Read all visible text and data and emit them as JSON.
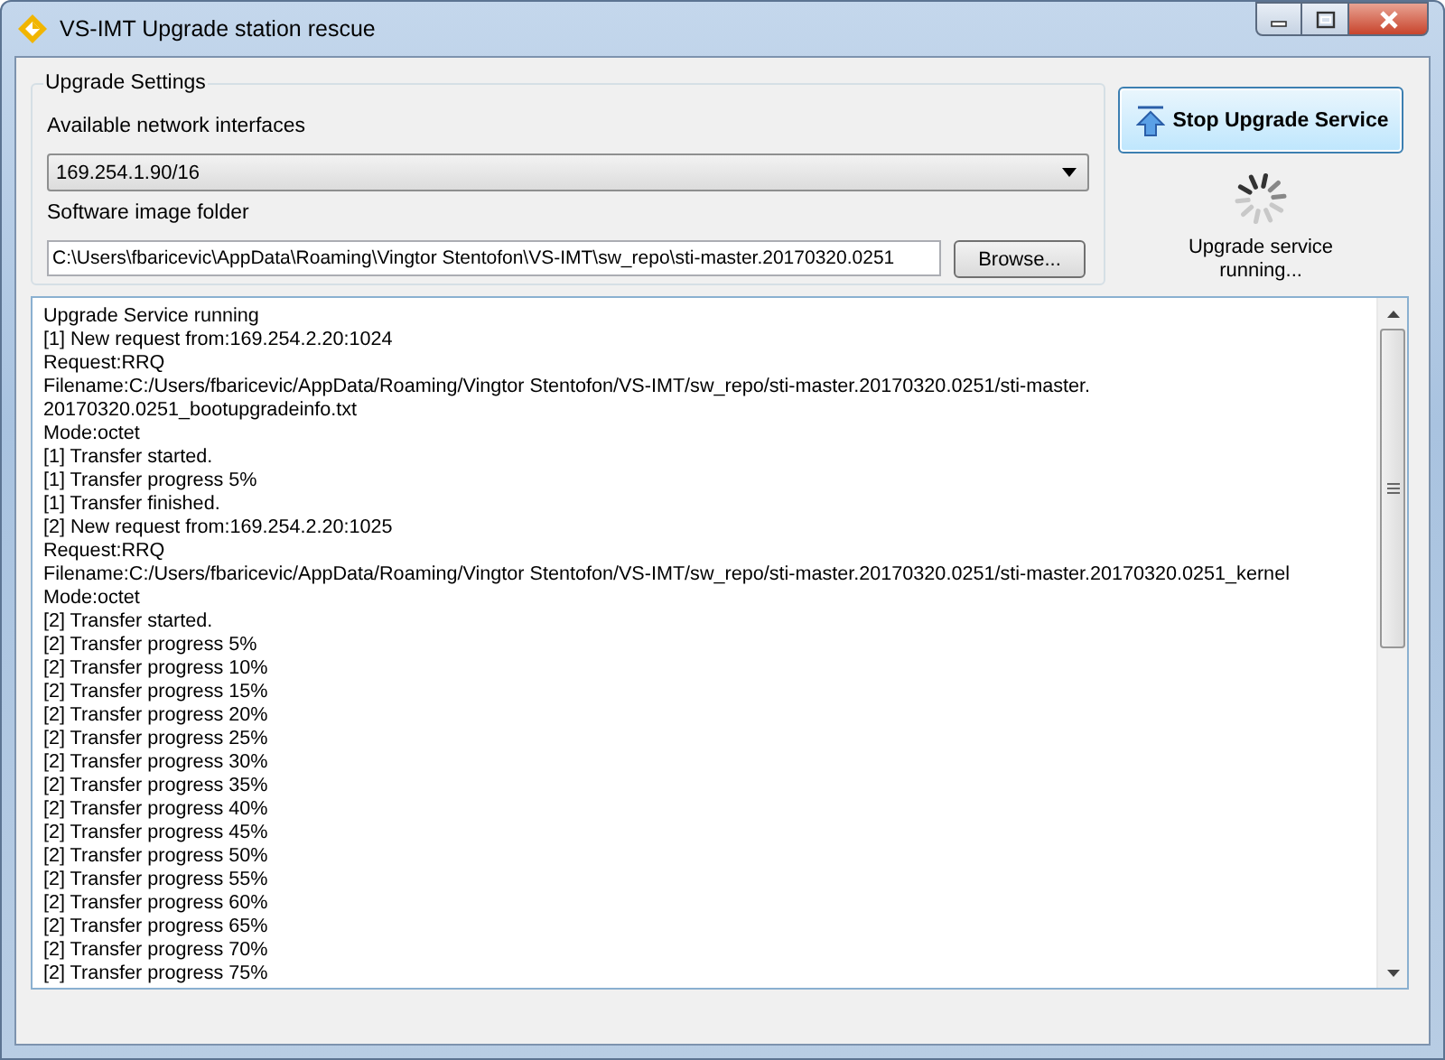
{
  "window": {
    "title": "VS-IMT Upgrade station rescue"
  },
  "upgrade_settings": {
    "title": "Upgrade Settings",
    "interface_label": "Available network interfaces",
    "interface_value": "169.254.1.90/16",
    "folder_label": "Software image folder",
    "folder_value": "C:\\Users\\fbaricevic\\AppData\\Roaming\\Vingtor Stentofon\\VS-IMT\\sw_repo\\sti-master.20170320.0251",
    "browse_button": "Browse..."
  },
  "service": {
    "button": "Stop Upgrade Service",
    "status": "Upgrade service running..."
  },
  "log": {
    "lines": [
      "Upgrade Service running",
      "[1] New request from:169.254.2.20:1024",
      "Request:RRQ",
      "Filename:C:/Users/fbaricevic/AppData/Roaming/Vingtor Stentofon/VS-IMT/sw_repo/sti-master.20170320.0251/sti-master.",
      "20170320.0251_bootupgradeinfo.txt",
      "Mode:octet",
      "[1] Transfer started.",
      "[1] Transfer progress 5%",
      "[1] Transfer finished.",
      "[2] New request from:169.254.2.20:1025",
      "Request:RRQ",
      "Filename:C:/Users/fbaricevic/AppData/Roaming/Vingtor Stentofon/VS-IMT/sw_repo/sti-master.20170320.0251/sti-master.20170320.0251_kernel",
      "Mode:octet",
      "[2] Transfer started.",
      "[2] Transfer progress 5%",
      "[2] Transfer progress 10%",
      "[2] Transfer progress 15%",
      "[2] Transfer progress 20%",
      "[2] Transfer progress 25%",
      "[2] Transfer progress 30%",
      "[2] Transfer progress 35%",
      "[2] Transfer progress 40%",
      "[2] Transfer progress 45%",
      "[2] Transfer progress 50%",
      "[2] Transfer progress 55%",
      "[2] Transfer progress 60%",
      "[2] Transfer progress 65%",
      "[2] Transfer progress 70%",
      "[2] Transfer progress 75%"
    ]
  }
}
